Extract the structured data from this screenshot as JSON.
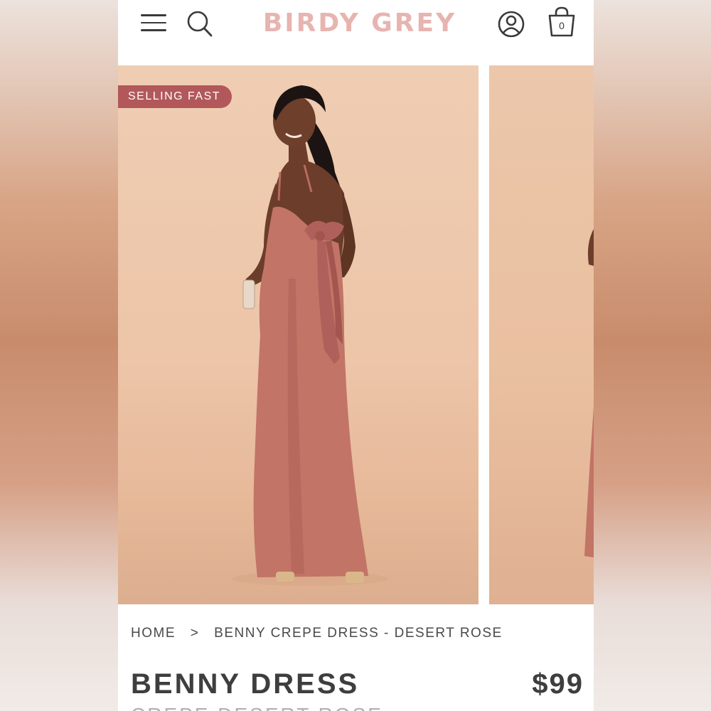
{
  "header": {
    "brand": "BIRDY GREY",
    "cart_count": "0",
    "icons": [
      "menu-icon",
      "search-icon",
      "account-icon",
      "shopping-bag-icon"
    ],
    "brand_color": "#e7b4b0"
  },
  "gallery": {
    "badge": "SELLING FAST",
    "badge_color": "#b2585a",
    "dress_color": "#c27466"
  },
  "breadcrumb": {
    "home": "HOME",
    "separator": ">",
    "current": "BENNY CREPE DRESS - DESERT ROSE"
  },
  "product": {
    "title": "BENNY DRESS",
    "price": "$99",
    "subtitle": "CREPE DESERT ROSE"
  }
}
